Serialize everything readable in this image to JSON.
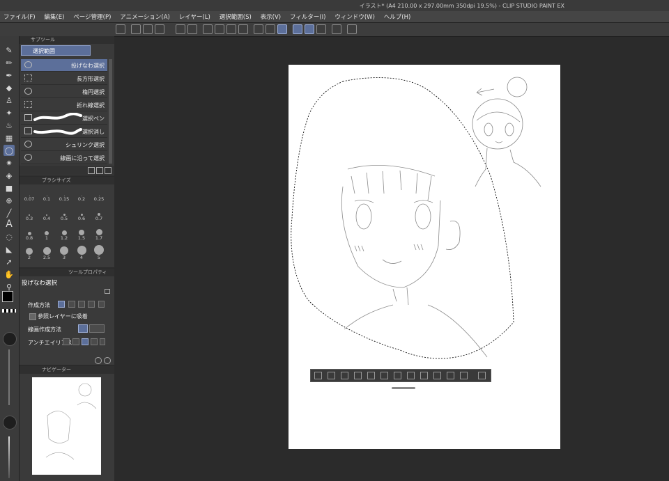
{
  "window": {
    "title": "イラスト* (A4 210.00 x 297.00mm 350dpi 19.5%) - CLIP STUDIO PAINT EX"
  },
  "menu": [
    "ファイル(F)",
    "編集(E)",
    "ページ管理(P)",
    "アニメーション(A)",
    "レイヤー(L)",
    "選択範囲(S)",
    "表示(V)",
    "フィルター(I)",
    "ウィンドウ(W)",
    "ヘルプ(H)"
  ],
  "subtool_panel": {
    "tab": "サブツール",
    "group": "選択範囲",
    "items": [
      {
        "label": "投げなわ選択",
        "icon": "lasso-icon",
        "active": true
      },
      {
        "label": "長方形選択",
        "icon": "rect-select-icon",
        "active": false
      },
      {
        "label": "楕円選択",
        "icon": "ellipse-select-icon",
        "active": false
      },
      {
        "label": "折れ線選択",
        "icon": "polyline-select-icon",
        "active": false
      },
      {
        "label": "選択ペン",
        "icon": "select-pen-icon",
        "active": false
      },
      {
        "label": "選択消し",
        "icon": "select-eraser-icon",
        "active": false
      },
      {
        "label": "シュリンク選択",
        "icon": "shrink-select-icon",
        "active": false
      },
      {
        "label": "線画に沿って選択",
        "icon": "lineart-select-icon",
        "active": false
      }
    ]
  },
  "brush_size": {
    "tab": "ブラシサイズ",
    "sizes": [
      "0.07",
      "0.1",
      "0.15",
      "0.2",
      "0.25",
      "0.3",
      "0.4",
      "0.5",
      "0.6",
      "0.7",
      "0.8",
      "1",
      "1.2",
      "1.5",
      "1.7",
      "2",
      "2.5",
      "3",
      "4",
      "5"
    ]
  },
  "tool_property": {
    "tabs": [
      "ツールプロパティ"
    ],
    "title": "投げなわ選択",
    "creation_method_label": "作成方法",
    "reference_layer_label": "参照レイヤーに吸着",
    "lineart_method_label": "線画作成方法",
    "antialias_label": "アンチエイリアス"
  },
  "navigator": {
    "tab": "ナビゲーター"
  },
  "colors": {
    "accent": "#5c6f9a",
    "main_color": "#000000",
    "sub_color": "#3b63d6"
  }
}
